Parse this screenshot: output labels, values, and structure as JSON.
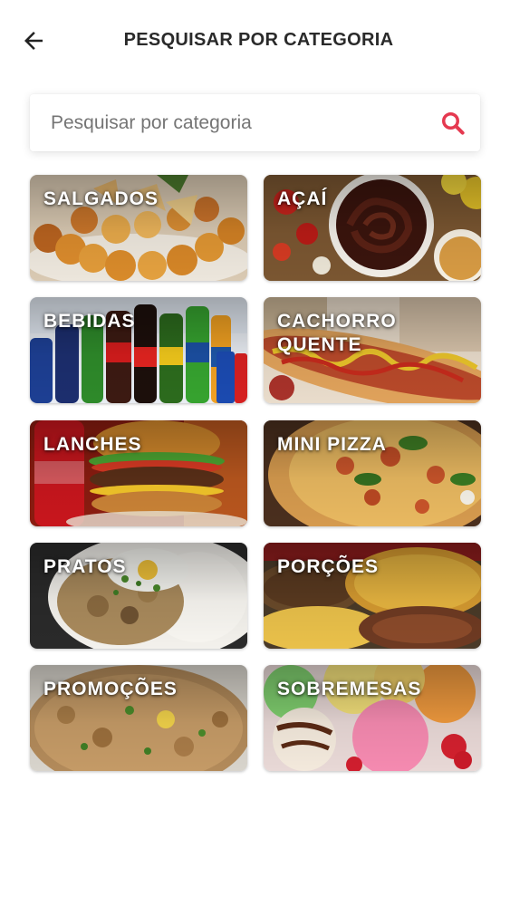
{
  "header": {
    "title": "PESQUISAR POR CATEGORIA",
    "back_icon": "arrow-left-icon"
  },
  "search": {
    "placeholder": "Pesquisar por categoria",
    "value": "",
    "icon": "search-icon",
    "icon_color": "#e53950"
  },
  "categories": [
    {
      "label": "SALGADOS"
    },
    {
      "label": "AÇAÍ"
    },
    {
      "label": "BEBIDAS"
    },
    {
      "label": "CACHORRO QUENTE"
    },
    {
      "label": "LANCHES"
    },
    {
      "label": "MINI PIZZA"
    },
    {
      "label": "PRATOS"
    },
    {
      "label": "PORÇÕES"
    },
    {
      "label": "PROMOÇÕES"
    },
    {
      "label": "SOBREMESAS"
    }
  ],
  "colors": {
    "accent": "#e53950",
    "title_text": "#2a2a2a",
    "background": "#ffffff"
  }
}
